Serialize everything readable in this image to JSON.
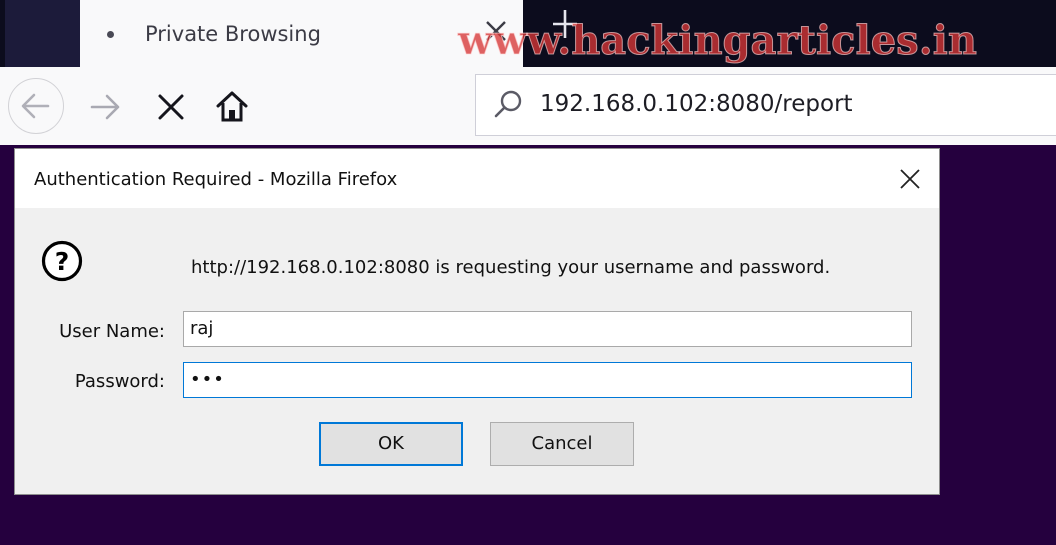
{
  "browser": {
    "tab": {
      "title": "Private Browsing"
    },
    "watermark": "www.hackingarticles.in",
    "url": "192.168.0.102:8080/report"
  },
  "dialog": {
    "title": "Authentication Required - Mozilla Firefox",
    "message": "http://192.168.0.102:8080 is requesting your username and password.",
    "username_label": "User Name:",
    "username_value": "raj",
    "password_label": "Password:",
    "password_value": "•••",
    "ok_label": "OK",
    "cancel_label": "Cancel"
  },
  "colors": {
    "tabstrip": "#0c0c1d",
    "content_background": "#25003e",
    "focus_accent": "#0078d7",
    "watermark": "#d63636"
  },
  "icons": [
    "tab-dot-icon",
    "tab-close-icon",
    "new-tab-icon",
    "back-icon",
    "forward-icon",
    "stop-icon",
    "home-icon",
    "search-icon",
    "dialog-close-icon",
    "question-icon"
  ]
}
